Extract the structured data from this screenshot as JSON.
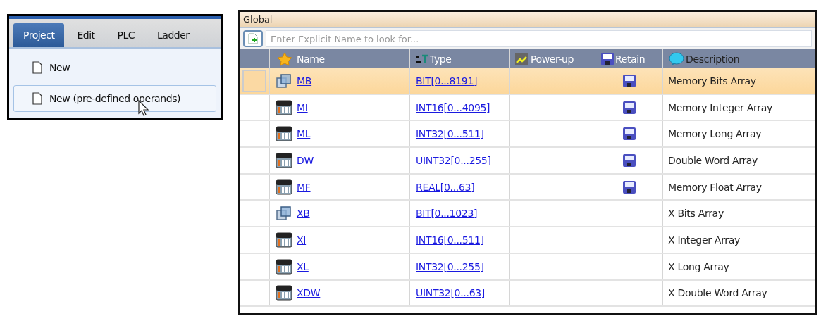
{
  "menu": {
    "tabs": [
      {
        "label": "Project",
        "selected": true
      },
      {
        "label": "Edit",
        "selected": false
      },
      {
        "label": "PLC",
        "selected": false
      },
      {
        "label": "Ladder",
        "selected": false
      }
    ],
    "items": [
      {
        "label": "New",
        "selected": false
      },
      {
        "label": "New (pre-defined operands)",
        "selected": true
      }
    ]
  },
  "global": {
    "title": "Global",
    "search": {
      "placeholder": "Enter Explicit Name to look for..."
    },
    "columns": [
      {
        "label": "Name",
        "kind": "name"
      },
      {
        "label": "Type",
        "kind": "type"
      },
      {
        "label": "Power-up",
        "kind": "powerup"
      },
      {
        "label": "Retain",
        "kind": "retain"
      },
      {
        "label": "Description",
        "kind": "description"
      }
    ],
    "rows": [
      {
        "kind": "bits",
        "name": "MB",
        "type": "BIT[0...8191]",
        "retain": true,
        "description": "Memory Bits Array",
        "selected": true
      },
      {
        "kind": "array",
        "name": "MI",
        "type": "INT16[0...4095]",
        "retain": true,
        "description": "Memory Integer Array",
        "selected": false
      },
      {
        "kind": "array",
        "name": "ML",
        "type": "INT32[0...511]",
        "retain": true,
        "description": "Memory Long Array",
        "selected": false
      },
      {
        "kind": "array",
        "name": "DW",
        "type": "UINT32[0...255]",
        "retain": true,
        "description": "Double Word Array",
        "selected": false
      },
      {
        "kind": "array",
        "name": "MF",
        "type": "REAL[0...63]",
        "retain": true,
        "description": "Memory Float Array",
        "selected": false
      },
      {
        "kind": "bits",
        "name": "XB",
        "type": "BIT[0...1023]",
        "retain": false,
        "description": "X Bits Array",
        "selected": false
      },
      {
        "kind": "array",
        "name": "XI",
        "type": "INT16[0...511]",
        "retain": false,
        "description": "X Integer Array",
        "selected": false
      },
      {
        "kind": "array",
        "name": "XL",
        "type": "INT32[0...255]",
        "retain": false,
        "description": "X Long Array",
        "selected": false
      },
      {
        "kind": "array",
        "name": "XDW",
        "type": "UINT32[0...63]",
        "retain": false,
        "description": "X Double Word Array",
        "selected": false
      }
    ]
  }
}
